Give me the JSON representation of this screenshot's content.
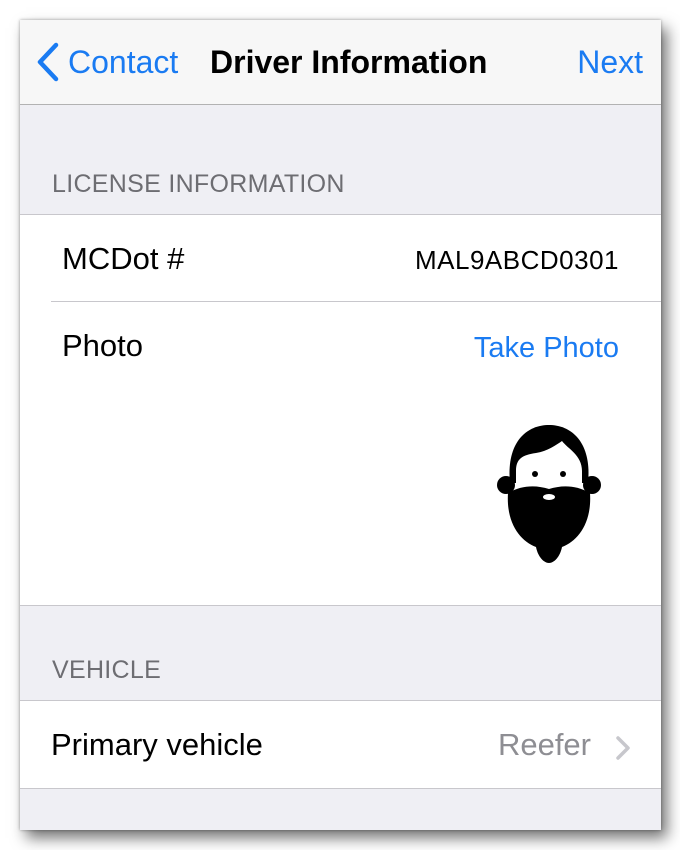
{
  "nav": {
    "back_label": "Contact",
    "title": "Driver Information",
    "next_label": "Next"
  },
  "license_section": {
    "header": "LICENSE INFORMATION",
    "mcdot_label": "MCDot #",
    "mcdot_value": "MAL9ABCD0301",
    "photo_label": "Photo",
    "take_photo_label": "Take Photo",
    "avatar_icon": "bearded-man-avatar-icon"
  },
  "vehicle_section": {
    "header": "VEHICLE",
    "primary_label": "Primary vehicle",
    "primary_value": "Reefer"
  },
  "colors": {
    "accent": "#1a7bf2",
    "background": "#efeff4",
    "secondary_text": "#8e8e93"
  }
}
